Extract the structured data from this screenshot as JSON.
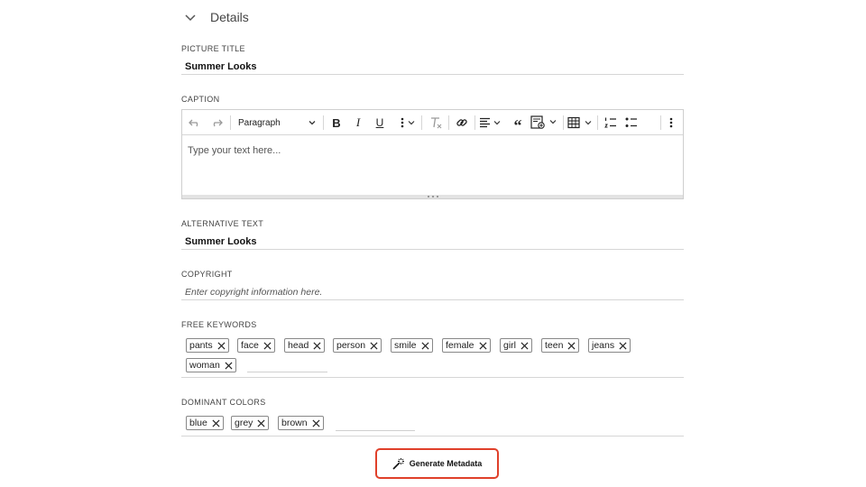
{
  "details": {
    "title": "Details"
  },
  "picture_title": {
    "label": "PICTURE TITLE",
    "value": "Summer Looks"
  },
  "caption": {
    "label": "CAPTION",
    "paragraph_select": "Paragraph",
    "placeholder": "Type your text here..."
  },
  "alt_text": {
    "label": "ALTERNATIVE TEXT",
    "value": "Summer Looks"
  },
  "copyright": {
    "label": "COPYRIGHT",
    "placeholder": "Enter copyright information here."
  },
  "free_keywords": {
    "label": "FREE KEYWORDS",
    "chips": [
      "pants",
      "face",
      "head",
      "person",
      "smile",
      "female",
      "girl",
      "teen",
      "jeans",
      "woman"
    ]
  },
  "dominant_colors": {
    "label": "DOMINANT COLORS",
    "chips": [
      "blue",
      "grey",
      "brown"
    ]
  },
  "generate_button": {
    "label": "Generate Metadata"
  },
  "colors": {
    "accent_border": "#e0402a"
  }
}
